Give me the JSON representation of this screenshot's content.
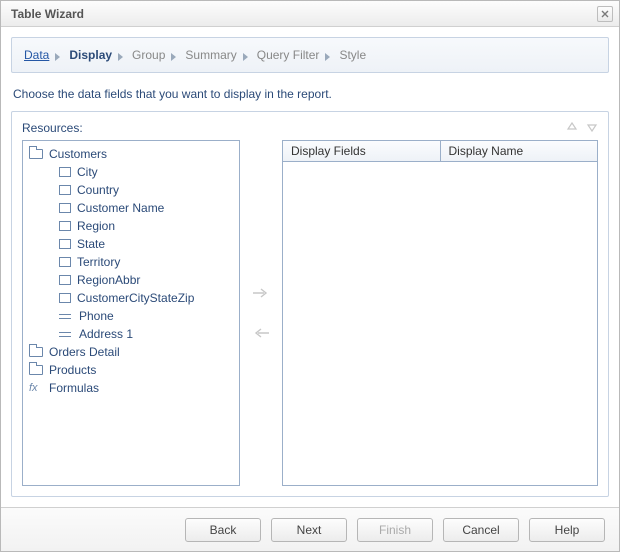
{
  "window": {
    "title": "Table Wizard"
  },
  "breadcrumb": {
    "items": [
      {
        "label": "Data",
        "link": true,
        "active": false
      },
      {
        "label": "Display",
        "link": false,
        "active": true
      },
      {
        "label": "Group",
        "link": false,
        "active": false
      },
      {
        "label": "Summary",
        "link": false,
        "active": false
      },
      {
        "label": "Query Filter",
        "link": false,
        "active": false
      },
      {
        "label": "Style",
        "link": false,
        "active": false
      }
    ]
  },
  "instruction": "Choose the data fields that you want to display in the report.",
  "resources": {
    "label": "Resources:"
  },
  "tree": {
    "root": "Customers",
    "children": [
      {
        "label": "City",
        "icon": "field"
      },
      {
        "label": "Country",
        "icon": "field"
      },
      {
        "label": "Customer Name",
        "icon": "field"
      },
      {
        "label": "Region",
        "icon": "field"
      },
      {
        "label": "State",
        "icon": "field"
      },
      {
        "label": "Territory",
        "icon": "field"
      },
      {
        "label": "RegionAbbr",
        "icon": "field"
      },
      {
        "label": "CustomerCityStateZip",
        "icon": "field"
      },
      {
        "label": "Phone",
        "icon": "text"
      },
      {
        "label": "Address 1",
        "icon": "text"
      }
    ],
    "siblings": [
      {
        "label": "Orders Detail",
        "icon": "folder"
      },
      {
        "label": "Products",
        "icon": "folder"
      },
      {
        "label": "Formulas",
        "icon": "fx"
      }
    ]
  },
  "grid": {
    "columns": [
      {
        "header": "Display Fields"
      },
      {
        "header": "Display Name"
      }
    ],
    "rows": []
  },
  "buttons": {
    "back": "Back",
    "next": "Next",
    "finish": "Finish",
    "cancel": "Cancel",
    "help": "Help",
    "finish_enabled": false
  }
}
